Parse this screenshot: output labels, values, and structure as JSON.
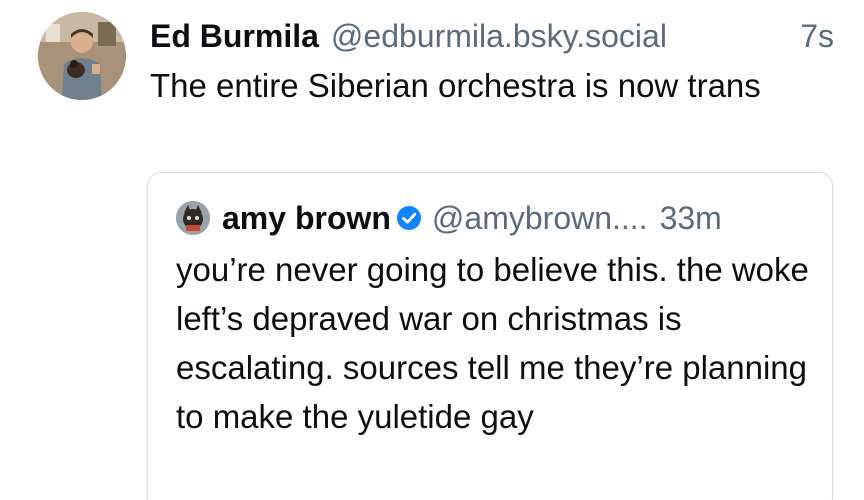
{
  "post": {
    "author": {
      "display_name": "Ed Burmila",
      "handle": "@edburmila.bsky.social",
      "avatar": "user-photo-avatar"
    },
    "time": "7s",
    "text": "The entire Siberian orchestra is now trans"
  },
  "quote": {
    "author": {
      "display_name": "amy brown",
      "verified": true,
      "verified_icon": "verified-check-badge-icon",
      "handle": "@amybrown....",
      "avatar": "user-photo-avatar"
    },
    "time": "33m",
    "text": "you’re never going to believe this. the woke left’s depraved war on christmas is escalating. sources tell me they’re planning to make the yuletide gay"
  },
  "colors": {
    "text": "#0b0f14",
    "muted": "#5b6b7c",
    "border": "#d4dbe2",
    "verified": "#1083fe"
  }
}
